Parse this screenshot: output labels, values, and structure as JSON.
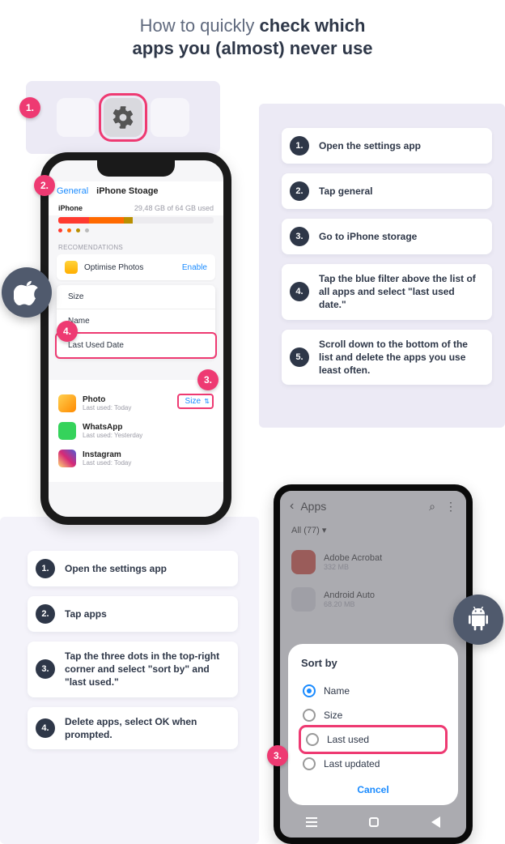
{
  "title_light": "How to quickly ",
  "title_bold1": "check which",
  "title_bold2": "apps you (almost) never use",
  "ios_steps": [
    "Open the settings app",
    "Tap general",
    "Go to iPhone storage",
    "Tap the blue filter above the list of all apps and select \"last used date.\"",
    "Scroll down to the bottom of the list and delete the apps you use least often."
  ],
  "android_steps": [
    "Open the settings app",
    "Tap apps",
    "Tap the three dots in the top-right corner and select \"sort by\" and \"last used.\"",
    "Delete apps, select OK when prompted."
  ],
  "iphone": {
    "back": "General",
    "title": "iPhone Stoage",
    "device": "iPhone",
    "usage": "29,48 GB of 64 GB used",
    "rec_label": "RECOMENDATIONS",
    "optimise": "Optimise Photos",
    "enable": "Enable",
    "menu": {
      "size": "Size",
      "name": "Name",
      "last": "Last Used Date"
    },
    "sort_chip": "Size",
    "apps": [
      {
        "name": "Photo",
        "sub": "Last used: Today"
      },
      {
        "name": "WhatsApp",
        "sub": "Last used: Yesterday"
      },
      {
        "name": "Instagram",
        "sub": "Last used: Today"
      }
    ]
  },
  "android": {
    "header": "Apps",
    "all": "All (77) ▾",
    "apps": [
      {
        "name": "Adobe Acrobat",
        "sub": "332 MB"
      },
      {
        "name": "Android Auto",
        "sub": "68.20 MB"
      }
    ],
    "sheet_title": "Sort by",
    "radios": {
      "name": "Name",
      "size": "Size",
      "last": "Last used",
      "updated": "Last updated"
    },
    "cancel": "Cancel"
  },
  "badges": {
    "b1": "1.",
    "b2": "2.",
    "b3": "3.",
    "b4": "4."
  }
}
